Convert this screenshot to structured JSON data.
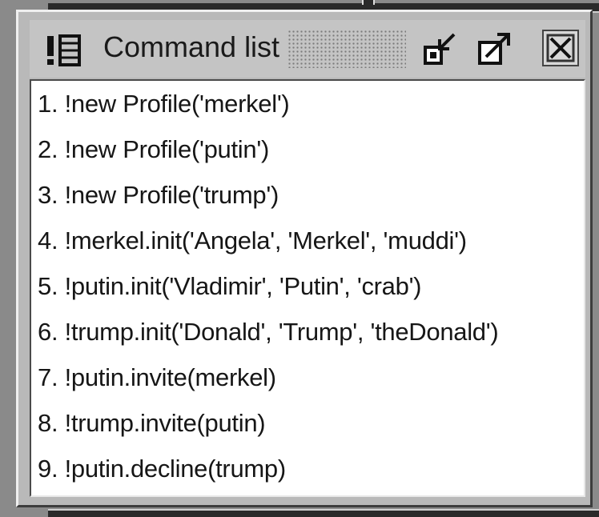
{
  "window": {
    "title": "Command list",
    "icons": {
      "app": "command-list-icon",
      "minimize": "minimize-icon",
      "maximize": "maximize-icon",
      "close": "close-icon"
    }
  },
  "commands": [
    {
      "num": "1.",
      "text": "!new Profile('merkel')"
    },
    {
      "num": "2.",
      "text": "!new Profile('putin')"
    },
    {
      "num": "3.",
      "text": "!new Profile('trump')"
    },
    {
      "num": "4.",
      "text": "!merkel.init('Angela', 'Merkel', 'muddi')"
    },
    {
      "num": "5.",
      "text": "!putin.init('Vladimir', 'Putin', 'crab')"
    },
    {
      "num": "6.",
      "text": "!trump.init('Donald', 'Trump', 'theDonald')"
    },
    {
      "num": "7.",
      "text": "!putin.invite(merkel)"
    },
    {
      "num": "8.",
      "text": "!trump.invite(putin)"
    },
    {
      "num": "9.",
      "text": "!putin.decline(trump)"
    }
  ]
}
